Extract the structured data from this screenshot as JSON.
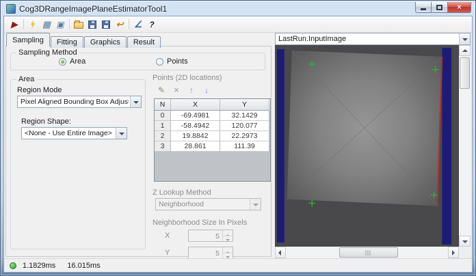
{
  "window": {
    "title": "Cog3DRangeImagePlaneEstimatorTool1",
    "close_glyph": "×"
  },
  "toolbar": {
    "icons": [
      {
        "name": "run-button",
        "glyph": "▶"
      },
      {
        "name": "auto-run-icon"
      },
      {
        "name": "image-grid-icon",
        "glyph": "▦"
      },
      {
        "name": "float-window-icon",
        "glyph": "▣"
      },
      {
        "name": "open-file-icon"
      },
      {
        "name": "save-file-icon"
      },
      {
        "name": "save-as-icon"
      },
      {
        "name": "import-export-icon",
        "glyph": "↩"
      },
      {
        "name": "units-icon",
        "glyph": "∠"
      },
      {
        "name": "help-icon",
        "glyph": "?"
      }
    ]
  },
  "tabs": {
    "items": [
      {
        "label": "Sampling",
        "active": true
      },
      {
        "label": "Fitting",
        "active": false
      },
      {
        "label": "Graphics",
        "active": false
      },
      {
        "label": "Result",
        "active": false
      }
    ]
  },
  "sampling": {
    "group_label": "Sampling Method",
    "area_option": "Area",
    "points_option": "Points"
  },
  "area": {
    "group_label": "Area",
    "region_mode_label": "Region Mode",
    "region_mode_value": "Pixel Aligned Bounding Box Adjust Mask",
    "region_shape_label": "Region Shape:",
    "region_shape_value": "<None - Use Entire Image>"
  },
  "points": {
    "section_label": "Points (2D locations)",
    "mini_icons": [
      {
        "name": "edit-points-icon",
        "glyph": "✎"
      },
      {
        "name": "delete-point-icon",
        "glyph": "×"
      },
      {
        "name": "move-up-icon",
        "glyph": "↑"
      },
      {
        "name": "move-down-icon",
        "glyph": "↓"
      }
    ],
    "table": {
      "headers": [
        "N",
        "X",
        "Y"
      ],
      "rows": [
        [
          "0",
          "-69.4981",
          "32.1429"
        ],
        [
          "1",
          "-58.4942",
          "120.077"
        ],
        [
          "2",
          "19.8842",
          "22.2973"
        ],
        [
          "3",
          "28.861",
          "111.39"
        ]
      ]
    },
    "z_lookup_label": "Z Lookup Method",
    "z_lookup_value": "Neighborhood",
    "neighborhood_label": "Neighborhood Size In Pixels",
    "x_label": "X",
    "x_value": "5",
    "y_label": "Y",
    "y_value": "5"
  },
  "display": {
    "image_selector": "LastRun.InputImage",
    "marker_color": "#2eb82e",
    "edge_color": "#b03028"
  },
  "status": {
    "time_primary": "1.1829ms",
    "time_secondary": "16.015ms"
  }
}
